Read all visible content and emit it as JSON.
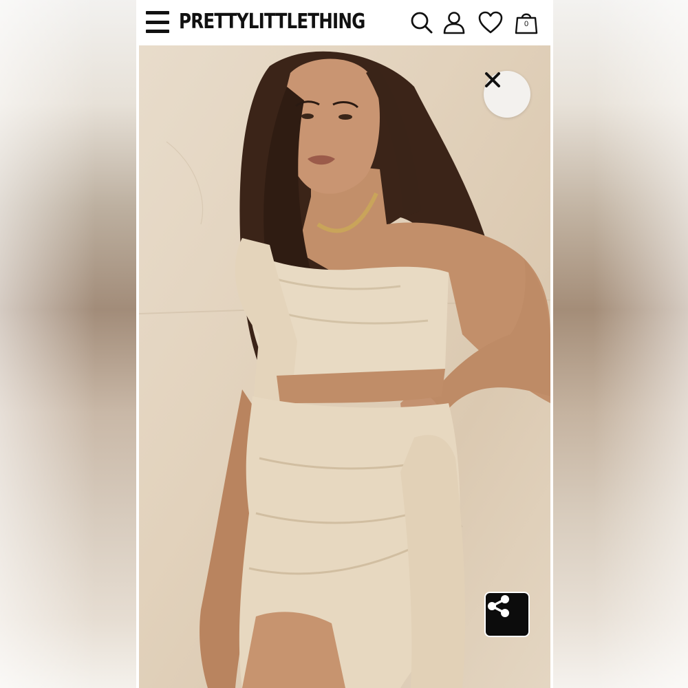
{
  "header": {
    "brand": "PRETTYLITTLETHING",
    "bag_count": "0",
    "icons": [
      "menu-icon",
      "search-icon",
      "account-icon",
      "wishlist-heart-icon",
      "shopping-bag-icon"
    ]
  },
  "gallery": {
    "image_alt": "Model wearing cream linen twist bandeau top and tie-side mini skirt",
    "close_icon": "close-icon",
    "share_icon": "share-icon"
  },
  "colors": {
    "header_bg": "#ffffff",
    "icon_color": "#111111",
    "share_bg": "#0c0c0c",
    "close_bg": "#f3f1ee",
    "fabric": "#e9dcc6"
  }
}
